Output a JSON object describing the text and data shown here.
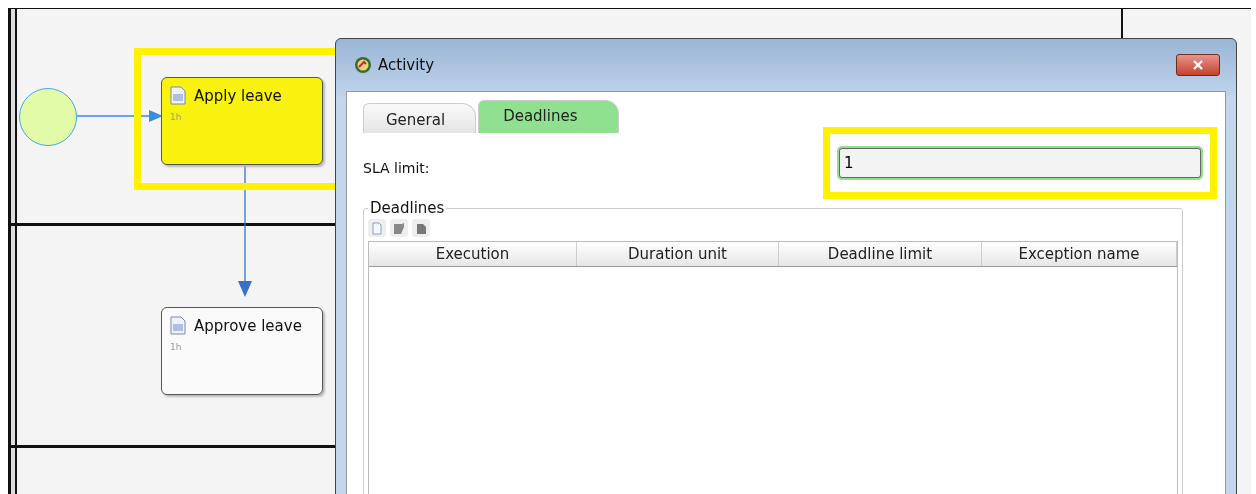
{
  "diagram": {
    "tasks": [
      {
        "label": "Apply leave",
        "duration": "1h",
        "selected": true
      },
      {
        "label": "Approve leave",
        "duration": "1h",
        "selected": false
      }
    ]
  },
  "dialog": {
    "title": "Activity",
    "tabs": [
      {
        "label": "General",
        "selected": false
      },
      {
        "label": "Deadlines",
        "selected": true
      }
    ],
    "sla_limit": {
      "label": "SLA limit:",
      "value": "1"
    },
    "deadlines": {
      "title": "Deadlines",
      "columns": [
        "Execution",
        "Duration unit",
        "Deadline limit",
        "Exception name"
      ]
    }
  }
}
